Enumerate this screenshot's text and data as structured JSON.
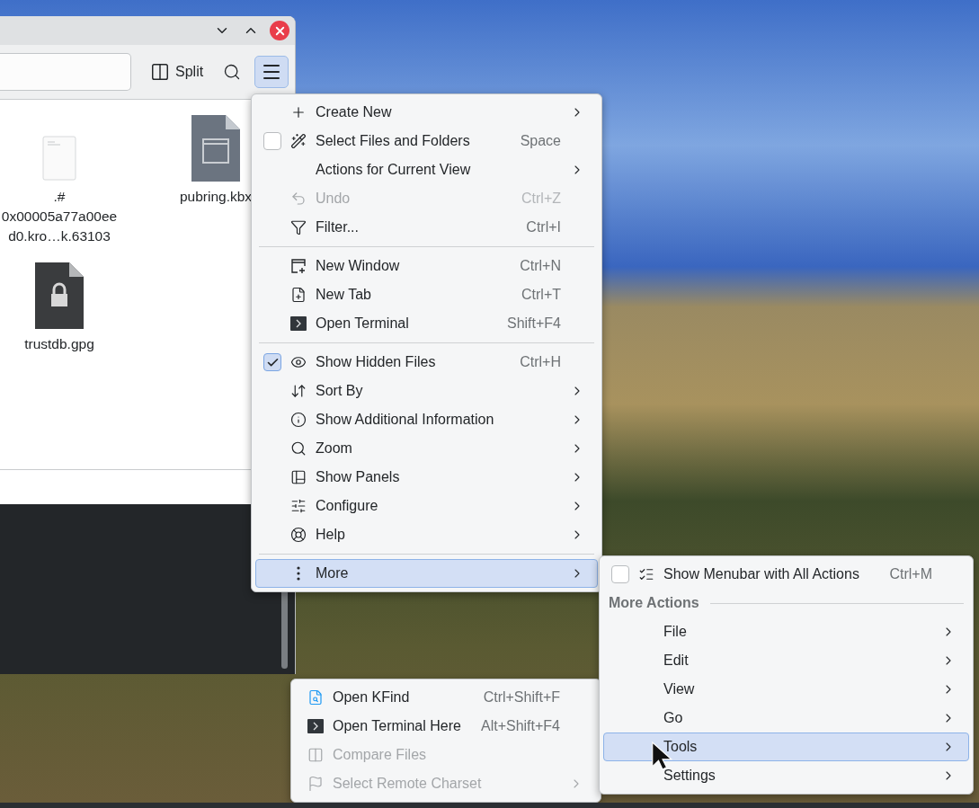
{
  "file_manager": {
    "toolbar": {
      "split": "Split",
      "menu_pressed": true
    },
    "files": [
      {
        "kind": "text",
        "name_lines": [
          ".#",
          "0x00005a77a00ee",
          "d0.kro…k.63103"
        ]
      },
      {
        "kind": "unknown",
        "name_lines": [
          "pubring.kbx"
        ]
      },
      {
        "kind": "locked",
        "name_lines": [
          "trustdb.gpg"
        ]
      }
    ]
  },
  "menus": [
    {
      "items": [
        {
          "kind": "action",
          "label": "Create New",
          "submenu": true,
          "selected": false,
          "disabled": false
        },
        {
          "kind": "action",
          "label": "Select Files and Folders",
          "shortcut": "Space",
          "checked": false,
          "submenu": false,
          "selected": false,
          "disabled": false
        },
        {
          "kind": "action",
          "label": "Actions for Current View",
          "submenu": true,
          "selected": false,
          "disabled": false
        },
        {
          "kind": "action",
          "label": "Undo",
          "shortcut": "Ctrl+Z",
          "submenu": false,
          "selected": false,
          "disabled": true
        },
        {
          "kind": "action",
          "label": "Filter...",
          "shortcut": "Ctrl+I",
          "submenu": false,
          "selected": false,
          "disabled": false
        },
        {
          "kind": "separator"
        },
        {
          "kind": "action",
          "label": "New Window",
          "shortcut": "Ctrl+N",
          "submenu": false,
          "selected": false,
          "disabled": false
        },
        {
          "kind": "action",
          "label": "New Tab",
          "shortcut": "Ctrl+T",
          "submenu": false,
          "selected": false,
          "disabled": false
        },
        {
          "kind": "action",
          "label": "Open Terminal",
          "shortcut": "Shift+F4",
          "submenu": false,
          "selected": false,
          "disabled": false
        },
        {
          "kind": "separator"
        },
        {
          "kind": "action",
          "label": "Show Hidden Files",
          "shortcut": "Ctrl+H",
          "checked": true,
          "submenu": false,
          "selected": false,
          "disabled": false
        },
        {
          "kind": "action",
          "label": "Sort By",
          "submenu": true,
          "selected": false,
          "disabled": false
        },
        {
          "kind": "action",
          "label": "Show Additional Information",
          "submenu": true,
          "selected": false,
          "disabled": false
        },
        {
          "kind": "action",
          "label": "Zoom",
          "submenu": true,
          "selected": false,
          "disabled": false
        },
        {
          "kind": "action",
          "label": "Show Panels",
          "submenu": true,
          "selected": false,
          "disabled": false
        },
        {
          "kind": "action",
          "label": "Configure",
          "submenu": true,
          "selected": false,
          "disabled": false
        },
        {
          "kind": "action",
          "label": "Help",
          "submenu": true,
          "selected": false,
          "disabled": false
        },
        {
          "kind": "separator"
        },
        {
          "kind": "action",
          "label": "More",
          "submenu": true,
          "selected": true,
          "disabled": false
        }
      ]
    },
    {
      "items": [
        {
          "kind": "action",
          "label": "Open KFind",
          "shortcut": "Ctrl+Shift+F",
          "submenu": false,
          "selected": false,
          "disabled": false
        },
        {
          "kind": "action",
          "label": "Open Terminal Here",
          "shortcut": "Alt+Shift+F4",
          "submenu": false,
          "selected": false,
          "disabled": false
        },
        {
          "kind": "action",
          "label": "Compare Files",
          "submenu": false,
          "selected": false,
          "disabled": true
        },
        {
          "kind": "action",
          "label": "Select Remote Charset",
          "submenu": true,
          "selected": false,
          "disabled": true
        }
      ]
    },
    {
      "items": [
        {
          "kind": "action",
          "label": "Show Menubar with All Actions",
          "shortcut": "Ctrl+M",
          "checked": false,
          "submenu": false,
          "selected": false,
          "disabled": false
        },
        {
          "kind": "header",
          "label": "More Actions"
        },
        {
          "kind": "action",
          "label": "File",
          "submenu": true,
          "selected": false,
          "disabled": false
        },
        {
          "kind": "action",
          "label": "Edit",
          "submenu": true,
          "selected": false,
          "disabled": false
        },
        {
          "kind": "action",
          "label": "View",
          "submenu": true,
          "selected": false,
          "disabled": false
        },
        {
          "kind": "action",
          "label": "Go",
          "submenu": true,
          "selected": false,
          "disabled": false
        },
        {
          "kind": "action",
          "label": "Tools",
          "submenu": true,
          "selected": true,
          "disabled": false
        },
        {
          "kind": "action",
          "label": "Settings",
          "submenu": true,
          "selected": false,
          "disabled": false
        }
      ]
    }
  ]
}
